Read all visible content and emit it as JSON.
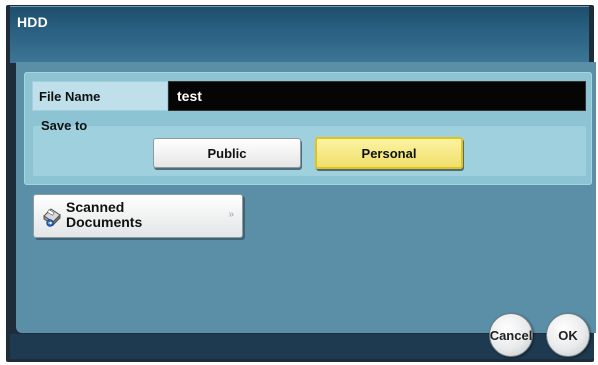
{
  "window": {
    "title": "HDD"
  },
  "file_name": {
    "label": "File Name",
    "value": "test"
  },
  "save_to": {
    "label": "Save to",
    "options": [
      "Public",
      "Personal"
    ],
    "selected": "Personal"
  },
  "scanned_documents": {
    "label_line1": "Scanned",
    "label_line2": "Documents",
    "arrow": "»",
    "icon": "scan-folder-icon"
  },
  "footer": {
    "cancel_label": "Cancel",
    "ok_label": "OK"
  },
  "colors": {
    "titlebar": "#295f80",
    "panel": "#8cc4d4",
    "main": "#5b8ea7",
    "selected_button": "#f0df6a"
  }
}
